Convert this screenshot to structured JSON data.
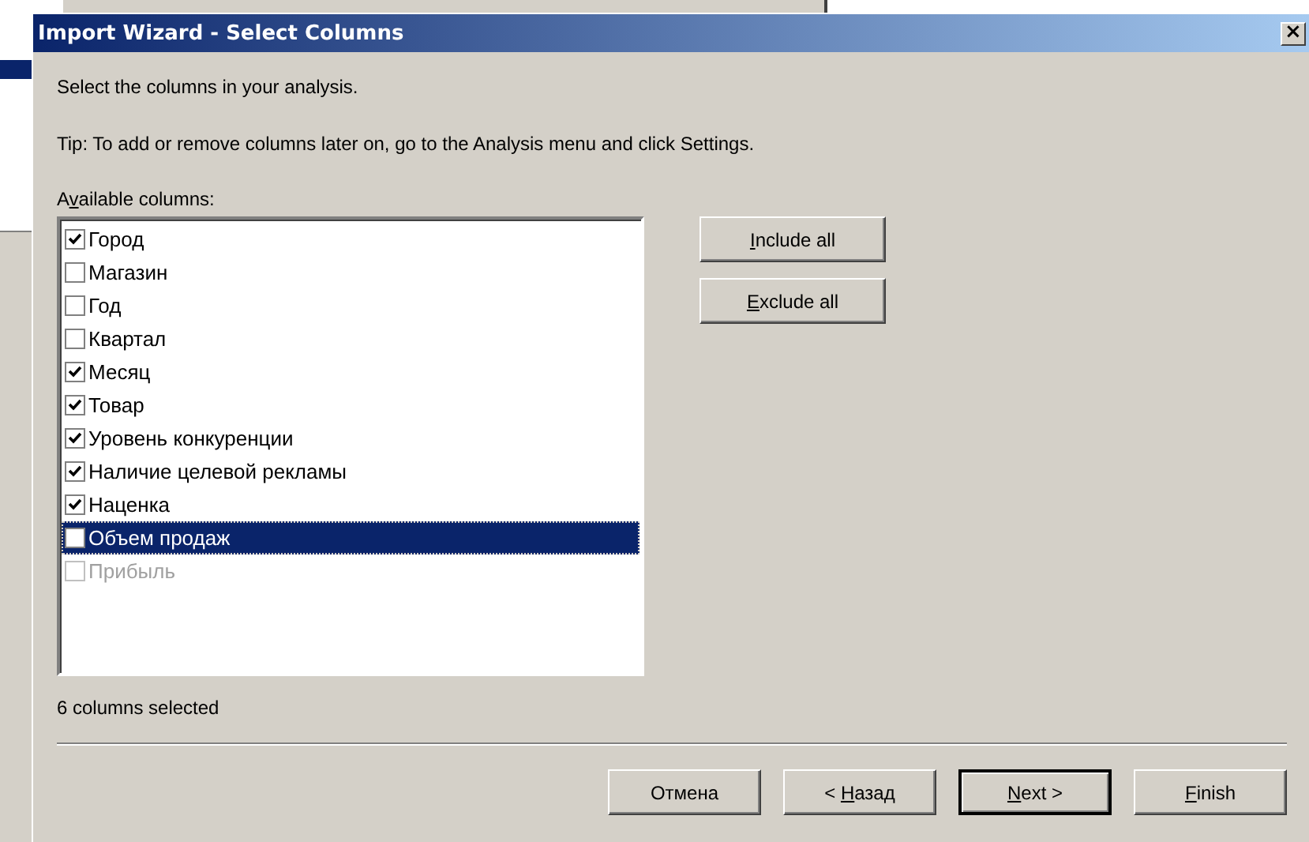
{
  "window": {
    "title": "Import Wizard - Select Columns",
    "close": "×"
  },
  "intro": "Select the columns in your analysis.",
  "tip": "Tip: To add or remove columns later on, go to the Analysis menu and click Settings.",
  "list_label": {
    "pre": "A",
    "key": "v",
    "post": "ailable columns:"
  },
  "columns": [
    {
      "name": "Город",
      "checked": true,
      "selected": false,
      "disabled": false
    },
    {
      "name": "Магазин",
      "checked": false,
      "selected": false,
      "disabled": false
    },
    {
      "name": "Год",
      "checked": false,
      "selected": false,
      "disabled": false
    },
    {
      "name": "Квартал",
      "checked": false,
      "selected": false,
      "disabled": false
    },
    {
      "name": "Месяц",
      "checked": true,
      "selected": false,
      "disabled": false
    },
    {
      "name": "Товар",
      "checked": true,
      "selected": false,
      "disabled": false
    },
    {
      "name": "Уровень конкуренции",
      "checked": true,
      "selected": false,
      "disabled": false
    },
    {
      "name": "Наличие целевой рекламы",
      "checked": true,
      "selected": false,
      "disabled": false
    },
    {
      "name": "Наценка",
      "checked": true,
      "selected": false,
      "disabled": false
    },
    {
      "name": "Объем продаж",
      "checked": false,
      "selected": true,
      "disabled": false
    },
    {
      "name": "Прибыль",
      "checked": false,
      "selected": false,
      "disabled": true
    }
  ],
  "side_buttons": [
    {
      "key": "I",
      "post": "nclude all"
    },
    {
      "key": "E",
      "post": "xclude all"
    }
  ],
  "status": "6 columns selected",
  "buttons": [
    {
      "post": "Отмена",
      "default": false
    },
    {
      "pre": "< ",
      "key": "Н",
      "post": "азад",
      "default": false
    },
    {
      "key": "N",
      "post": "ext >",
      "default": true
    },
    {
      "key": "F",
      "post": "inish",
      "default": false
    }
  ]
}
